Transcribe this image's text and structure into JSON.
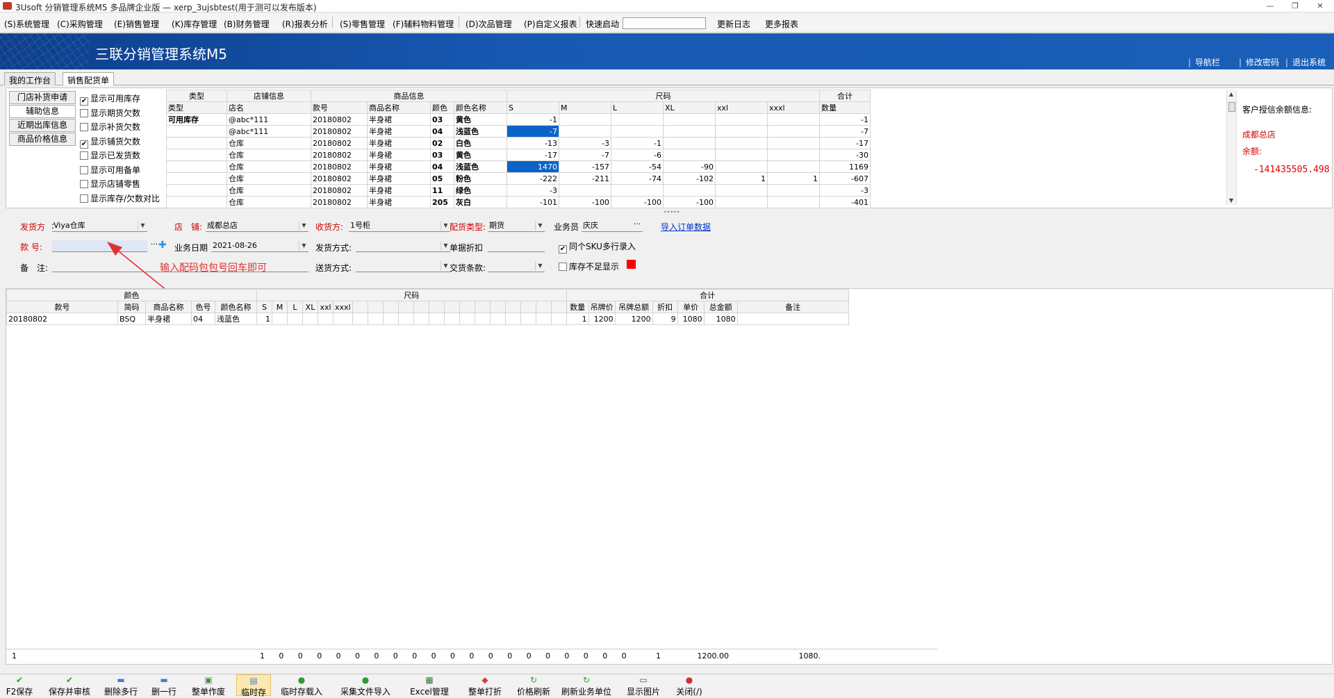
{
  "window": {
    "title": "3Usoft 分销管理系统M5 多品牌企业版 — xerp_3ujsbtest(用于测可以发布版本)",
    "controls": [
      "—",
      "❐",
      "✕"
    ]
  },
  "menu": {
    "items": [
      "(S)系统管理",
      "(C)采购管理",
      "(E)销售管理",
      "(K)库存管理",
      "(B)财务管理",
      "(R)报表分析",
      "(S)零售管理",
      "(F)辅料物料管理",
      "(D)次品管理",
      "(P)自定义报表"
    ],
    "quick_label": "快速启动",
    "quick_value": "",
    "extra": [
      "更新日志",
      "更多报表"
    ]
  },
  "banner": {
    "title": "三联分销管理系统M5",
    "nav": [
      "导航栏",
      "修改密码",
      "退出系统"
    ]
  },
  "tabs": [
    "我的工作台",
    "销售配货单"
  ],
  "side_tabs": [
    "门店补货申请",
    "辅助信息",
    "近期出库信息",
    "商品价格信息"
  ],
  "options": [
    {
      "label": "显示可用库存",
      "checked": true
    },
    {
      "label": "显示期货欠数",
      "checked": false
    },
    {
      "label": "显示补货欠数",
      "checked": false
    },
    {
      "label": "显示铺货欠数",
      "checked": true
    },
    {
      "label": "显示已发货数",
      "checked": false
    },
    {
      "label": "显示可用备单",
      "checked": false
    },
    {
      "label": "显示店铺零售",
      "checked": false
    },
    {
      "label": "显示库存/欠数对比",
      "checked": false
    }
  ],
  "stock": {
    "group_headers": [
      "类型",
      "店铺信息",
      "商品信息",
      "尺码",
      "合计"
    ],
    "columns": [
      "类型",
      "店名",
      "款号",
      "商品名称",
      "颜色",
      "颜色名称",
      "S",
      "M",
      "L",
      "XL",
      "xxl",
      "xxxl",
      "数量"
    ],
    "type_label": "可用库存",
    "rows": [
      [
        "@abc*111",
        "20180802",
        "半身裙",
        "03",
        "黄色",
        "-1",
        "",
        "",
        "",
        "",
        "",
        "-1"
      ],
      [
        "@abc*111",
        "20180802",
        "半身裙",
        "04",
        "浅蓝色",
        "-7",
        "",
        "",
        "",
        "",
        "",
        "-7"
      ],
      [
        "仓库",
        "20180802",
        "半身裙",
        "02",
        "白色",
        "-13",
        "-3",
        "-1",
        "",
        "",
        "",
        "-17"
      ],
      [
        "仓库",
        "20180802",
        "半身裙",
        "03",
        "黄色",
        "-17",
        "-7",
        "-6",
        "",
        "",
        "",
        "-30"
      ],
      [
        "仓库",
        "20180802",
        "半身裙",
        "04",
        "浅蓝色",
        "1470",
        "-157",
        "-54",
        "-90",
        "",
        "",
        "1169"
      ],
      [
        "仓库",
        "20180802",
        "半身裙",
        "05",
        "粉色",
        "-222",
        "-211",
        "-74",
        "-102",
        "1",
        "1",
        "-607"
      ],
      [
        "仓库",
        "20180802",
        "半身裙",
        "11",
        "绿色",
        "-3",
        "",
        "",
        "",
        "",
        "",
        "-3"
      ],
      [
        "仓库",
        "20180802",
        "半身裙",
        "205",
        "灰白",
        "-101",
        "-100",
        "-100",
        "-100",
        "",
        "",
        "-401"
      ]
    ]
  },
  "credit": {
    "title": "客户授信余额信息:",
    "store": "成都总店",
    "balance_label": "余额:",
    "balance": "-141435505.498"
  },
  "form": {
    "ship_from_label": "发货方",
    "ship_from": "Viya仓库",
    "store_label": "店　铺:",
    "store": "成都总店",
    "receiver_label": "收货方:",
    "receiver": "1号柜",
    "alloc_type_label": "配货类型:",
    "alloc_type": "期货",
    "salesman_label": "业务员",
    "salesman": "庆庆",
    "import_link": "导入订单数据",
    "style_no_label": "款 号:",
    "style_no": "",
    "biz_date_label": "业务日期",
    "biz_date": "2021-08-26",
    "ship_method_label": "发货方式:",
    "ship_method": "",
    "discount_label": "单据折扣",
    "discount": "",
    "multi_sku_label": "同个SKU多行录入",
    "multi_sku_checked": true,
    "remark_label": "备　注:",
    "remark": "",
    "delivery_label": "送货方式:",
    "delivery": "",
    "terms_label": "交货条款:",
    "terms": "",
    "low_stock_label": "库存不足显示",
    "low_stock_checked": false,
    "low_stock_color": "#ff0000"
  },
  "annotation": "输入配码包包号回车即可",
  "detail": {
    "group_headers": [
      "颜色",
      "尺码",
      "合计"
    ],
    "columns": [
      "款号",
      "简码",
      "商品名称",
      "色号",
      "颜色名称",
      "S",
      "M",
      "L",
      "XL",
      "xxl",
      "xxxl",
      "数量",
      "吊牌价",
      "吊牌总额",
      "折扣",
      "单价",
      "总金额",
      "备注"
    ],
    "rows": [
      [
        "20180802",
        "BSQ",
        "半身裙",
        "04",
        "浅蓝色",
        "1",
        "",
        "",
        "",
        "",
        "",
        "1",
        "1200",
        "1200",
        "9",
        "1080",
        "1080",
        ""
      ]
    ]
  },
  "totals": {
    "row_count": "1",
    "qty_cells": [
      "1",
      "0",
      "0",
      "0",
      "0",
      "0",
      "0",
      "0",
      "0",
      "0",
      "0",
      "0",
      "0",
      "0",
      "0",
      "0",
      "0",
      "0",
      "0",
      "0"
    ],
    "qty": "1",
    "tag_total": "1200.00",
    "amount": "1080."
  },
  "toolbar": [
    {
      "label": "F2保存",
      "icon": "check-icon",
      "glyph": "✔",
      "color": "#2e9b2e"
    },
    {
      "label": "保存并审核",
      "icon": "check-icon",
      "glyph": "✔",
      "color": "#2e9b2e"
    },
    {
      "label": "删除多行",
      "icon": "delete-rows-icon",
      "glyph": "▬",
      "color": "#4a7bd0"
    },
    {
      "label": "删一行",
      "icon": "delete-row-icon",
      "glyph": "▬",
      "color": "#4a7bd0"
    },
    {
      "label": "整单作废",
      "icon": "cart-icon",
      "glyph": "▣",
      "color": "#3c8c3c"
    },
    {
      "label": "临时存",
      "icon": "floppy-icon",
      "glyph": "▤",
      "color": "#4a7bd0"
    },
    {
      "label": "临时存载入",
      "icon": "load-icon",
      "glyph": "●",
      "color": "#2e9b2e"
    },
    {
      "label": "采集文件导入",
      "icon": "import-icon",
      "glyph": "●",
      "color": "#2e9b2e"
    },
    {
      "label": "Excel管理",
      "icon": "excel-icon",
      "glyph": "▦",
      "color": "#2e7d32"
    },
    {
      "label": "整单打折",
      "icon": "tag-icon",
      "glyph": "◆",
      "color": "#d04040"
    },
    {
      "label": "价格刷新",
      "icon": "refresh-icon",
      "glyph": "↻",
      "color": "#2e9b2e"
    },
    {
      "label": "刷新业务单位",
      "icon": "refresh-icon",
      "glyph": "↻",
      "color": "#2e9b2e"
    },
    {
      "label": "显示图片",
      "icon": "picture-icon",
      "glyph": "▭",
      "color": "#555555"
    },
    {
      "label": "关闭(/)",
      "icon": "close-icon",
      "glyph": "●",
      "color": "#d03030"
    }
  ]
}
